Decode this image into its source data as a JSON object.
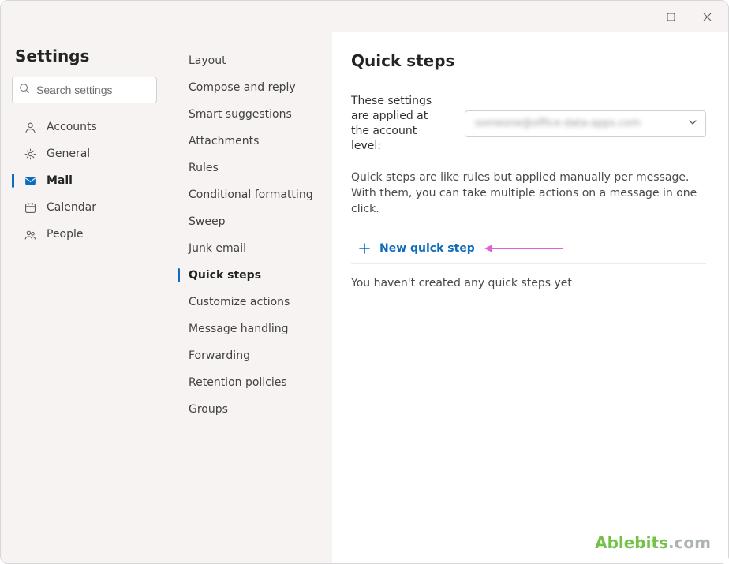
{
  "window": {
    "titlebar": {
      "min": "minimize",
      "max": "maximize",
      "close": "close"
    }
  },
  "sidebar": {
    "title": "Settings",
    "search_placeholder": "Search settings",
    "items": [
      {
        "id": "accounts",
        "label": "Accounts",
        "active": false
      },
      {
        "id": "general",
        "label": "General",
        "active": false
      },
      {
        "id": "mail",
        "label": "Mail",
        "active": true
      },
      {
        "id": "calendar",
        "label": "Calendar",
        "active": false
      },
      {
        "id": "people",
        "label": "People",
        "active": false
      }
    ]
  },
  "middle": {
    "items": [
      {
        "id": "layout",
        "label": "Layout",
        "active": false
      },
      {
        "id": "compose",
        "label": "Compose and reply",
        "active": false
      },
      {
        "id": "smart",
        "label": "Smart suggestions",
        "active": false
      },
      {
        "id": "attachments",
        "label": "Attachments",
        "active": false
      },
      {
        "id": "rules",
        "label": "Rules",
        "active": false
      },
      {
        "id": "condformat",
        "label": "Conditional formatting",
        "active": false
      },
      {
        "id": "sweep",
        "label": "Sweep",
        "active": false
      },
      {
        "id": "junk",
        "label": "Junk email",
        "active": false
      },
      {
        "id": "quicksteps",
        "label": "Quick steps",
        "active": true
      },
      {
        "id": "customize",
        "label": "Customize actions",
        "active": false
      },
      {
        "id": "msghandling",
        "label": "Message handling",
        "active": false
      },
      {
        "id": "forwarding",
        "label": "Forwarding",
        "active": false
      },
      {
        "id": "retention",
        "label": "Retention policies",
        "active": false
      },
      {
        "id": "groups",
        "label": "Groups",
        "active": false
      }
    ]
  },
  "main": {
    "title": "Quick steps",
    "account_label": "These settings are applied at the account level:",
    "account_value": "someone@office-data-apps.com",
    "description": "Quick steps are like rules but applied manually per message. With them, you can take multiple actions on a message in one click.",
    "new_button": "New quick step",
    "empty_state": "You haven't created any quick steps yet"
  },
  "watermark": {
    "brand_a": "Ablebits",
    "brand_b": ".com"
  }
}
